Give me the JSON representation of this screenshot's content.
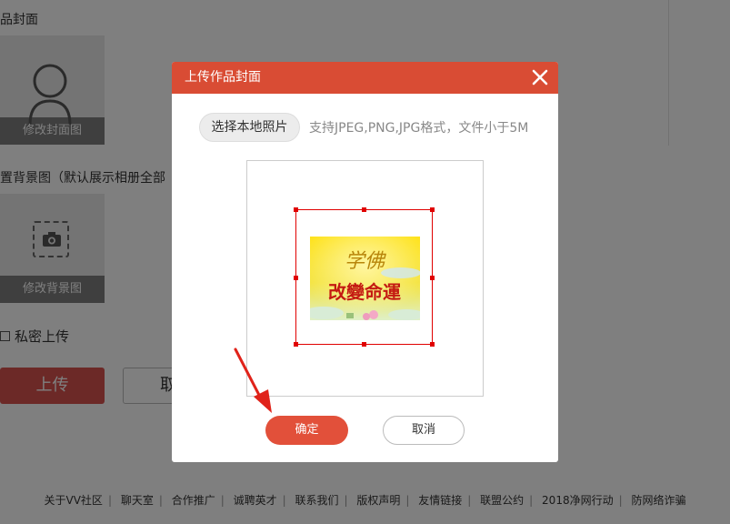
{
  "background": {
    "cover_label": "作品封面",
    "cover_caption": "修改封面图",
    "bg_label": "设置背景图（默认展示相册全部",
    "bg_caption": "修改背景图",
    "private_label": "私密上传",
    "upload_label": "上传",
    "cancel_label": "取"
  },
  "footer": {
    "links": [
      "关于VV社区",
      "聊天室",
      "合作推广",
      "诚聘英才",
      "联系我们",
      "版权声明",
      "友情链接",
      "联盟公约",
      "2018净网行动",
      "防网络诈骗"
    ]
  },
  "modal": {
    "title": "上传作品封面",
    "choose_label": "选择本地照片",
    "hint": "支持JPEG,PNG,JPG格式，文件小于5M",
    "photo_line1": "学佛",
    "photo_line2": "改變命運",
    "confirm_label": "确定",
    "cancel_label": "取消"
  },
  "colors": {
    "header": "#d94c34",
    "confirm": "#e2503a",
    "crop": "#e00000"
  }
}
